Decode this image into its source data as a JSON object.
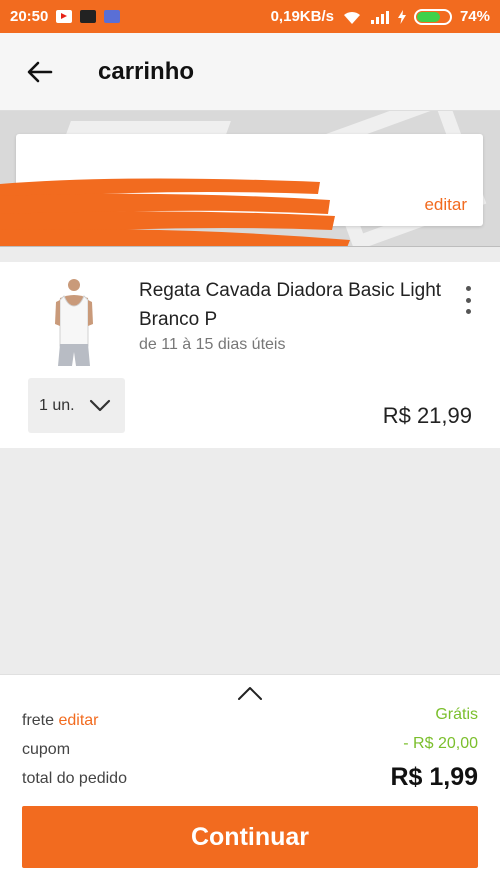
{
  "status_bar": {
    "time": "20:50",
    "net_speed": "0,19KB/s",
    "battery": "74%",
    "battery_level": 0.74
  },
  "app_bar": {
    "title": "carrinho",
    "back_icon": "arrow-left-icon"
  },
  "address": {
    "edit_label": "editar"
  },
  "cart_item": {
    "name": "Regata Cavada Diadora Basic Light Branco P",
    "delivery": "de 11 à 15 dias úteis",
    "quantity": "1 un.",
    "price": "R$ 21,99"
  },
  "summary": {
    "frete_label": "frete",
    "frete_edit": "editar",
    "frete_value": "Grátis",
    "cupom_label": "cupom",
    "cupom_value": "- R$ 20,00",
    "total_label": "total do pedido",
    "total_value": "R$ 1,99",
    "continue_label": "Continuar"
  },
  "colors": {
    "accent": "#f26b1f",
    "green": "#7bbf2c"
  }
}
